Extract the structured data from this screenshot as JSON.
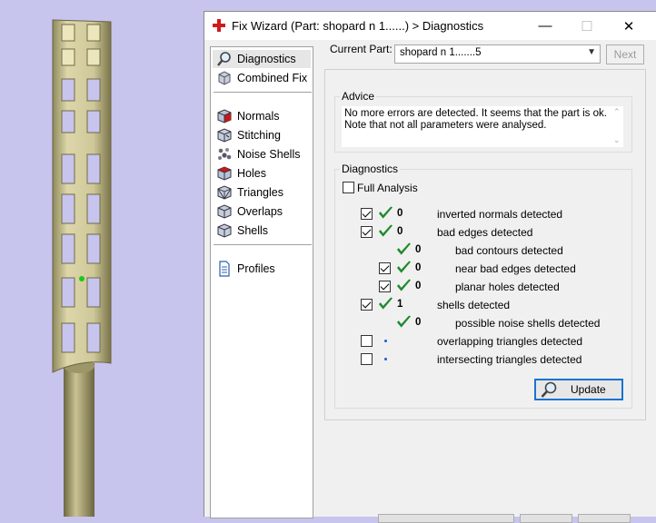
{
  "window": {
    "title": "Fix Wizard (Part: shopard n 1......) > Diagnostics",
    "minimize": "—",
    "maximize": "☐",
    "close": "✕"
  },
  "nav": {
    "items": [
      {
        "label": "Diagnostics",
        "icon": "magnifier-icon",
        "selected": true
      },
      {
        "label": "Combined Fix",
        "icon": "combined-fix-icon"
      },
      {
        "label": "Normals",
        "icon": "normals-cube-icon"
      },
      {
        "label": "Stitching",
        "icon": "stitching-cube-icon"
      },
      {
        "label": "Noise Shells",
        "icon": "noise-shells-icon"
      },
      {
        "label": "Holes",
        "icon": "holes-cube-icon"
      },
      {
        "label": "Triangles",
        "icon": "triangles-cube-icon"
      },
      {
        "label": "Overlaps",
        "icon": "overlaps-cube-icon"
      },
      {
        "label": "Shells",
        "icon": "shells-cube-icon"
      },
      {
        "label": "Profiles",
        "icon": "profiles-document-icon"
      }
    ]
  },
  "part": {
    "label": "Current Part:",
    "value": "shopard n 1.......5",
    "next_label": "Next"
  },
  "advice": {
    "legend": "Advice",
    "line1": "No more errors are detected. It seems that the part is ok.",
    "line2": "Note that not all parameters were analysed."
  },
  "diagnostics": {
    "legend": "Diagnostics",
    "full_analysis_label": "Full Analysis",
    "full_analysis_checked": false,
    "rows": [
      {
        "checkbox": true,
        "checked": true,
        "status": "ok",
        "count": "0",
        "label": "inverted normals detected"
      },
      {
        "checkbox": true,
        "checked": true,
        "status": "ok",
        "count": "0",
        "label": "bad edges detected"
      },
      {
        "checkbox": false,
        "status": "ok",
        "count": "0",
        "label": "bad contours detected"
      },
      {
        "checkbox": true,
        "checked": true,
        "status": "ok",
        "count": "0",
        "label": "near bad edges detected"
      },
      {
        "checkbox": true,
        "checked": true,
        "status": "ok",
        "count": "0",
        "label": "planar holes detected"
      },
      {
        "checkbox": true,
        "checked": true,
        "status": "ok",
        "count": "1",
        "label": "shells detected"
      },
      {
        "checkbox": false,
        "status": "ok",
        "count": "0",
        "label": "possible noise shells detected"
      },
      {
        "checkbox": true,
        "checked": false,
        "status": "pending",
        "count": "",
        "label": "overlapping triangles detected"
      },
      {
        "checkbox": true,
        "checked": false,
        "status": "pending",
        "count": "",
        "label": "intersecting triangles detected"
      }
    ],
    "update_label": "Update"
  },
  "colors": {
    "viewport_bg": "#c7c4ee",
    "model_body": "#d8d2a6",
    "check_green": "#1f8a2c",
    "accent_blue": "#1a73d1"
  }
}
